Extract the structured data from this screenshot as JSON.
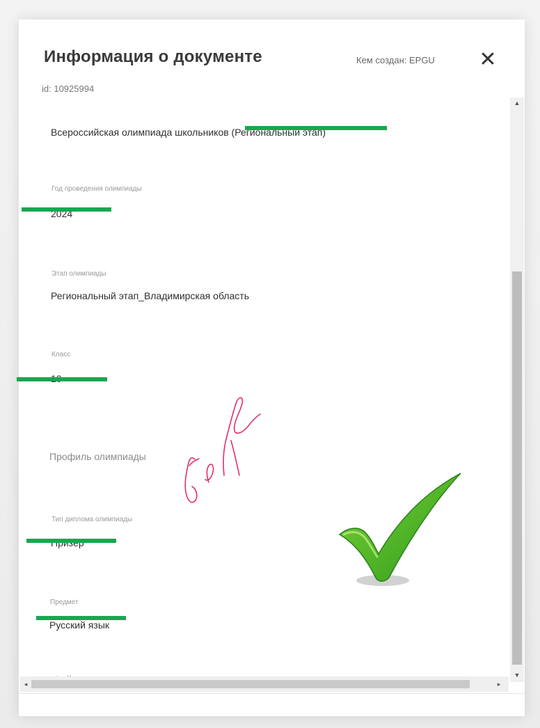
{
  "header": {
    "title": "Информация о документе",
    "creator": "Кем создан: EPGU",
    "close_icon": "close-icon",
    "doc_id": "id: 10925994"
  },
  "fields": {
    "olympiad_name": "Всероссийская олимпиада школьников (Региональный этап)",
    "year_label": "Год проведения олимпиады",
    "year_value": "2024",
    "stage_label": "Этап олимпиады",
    "stage_value": "Региональный этап_Владимирская область",
    "class_label": "Класс",
    "class_value": "10",
    "profile_label": "Профиль олимпиады",
    "diploma_label": "Тип диплома олимпиады",
    "diploma_value": "Призёр",
    "subject_label": "Предмет",
    "subject_value": "Русский язык",
    "no_files": "Файлы для скачивания отсутствуют"
  },
  "scrollbars": {
    "up_arrow": "▲",
    "down_arrow": "▼",
    "left_arrow": "◂",
    "right_arrow": "▸"
  },
  "colors": {
    "highlight": "#1aa64f",
    "signature_ink": "#e0306a",
    "check_green": "#3fae1f"
  },
  "annotations": {
    "signature_icon": "handwritten-signature-icon",
    "check_icon": "check-mark-icon"
  }
}
